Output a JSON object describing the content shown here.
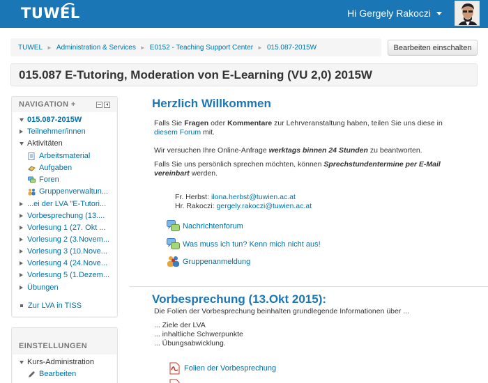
{
  "topbar": {
    "logo": "TUWEL",
    "greeting": "Hi Gergely Rakoczi",
    "colors": {
      "bar": "#1b76b6"
    }
  },
  "breadcrumb": [
    "TUWEL",
    "Administration & Services",
    "E0152 - Teaching Support Center",
    "015.087-2015W"
  ],
  "edit_button": "Bearbeiten einschalten",
  "page_title": "015.087 E-Tutoring, Moderation von E-Learning (VU 2,0) 2015W",
  "navigation": {
    "title": "NAVIGATION",
    "add_symbol": "+",
    "items": [
      {
        "label": "015.087-2015W",
        "icon": "tri-down"
      },
      {
        "label": "Teilnehmer/innen",
        "icon": "tri-right"
      },
      {
        "label": "Aktivitäten",
        "icon": "tri-down"
      },
      {
        "label": "Arbeitsmaterial",
        "icon": "resource-icon"
      },
      {
        "label": "Aufgaben",
        "icon": "assignment-icon"
      },
      {
        "label": "Foren",
        "icon": "forum-icon"
      },
      {
        "label": "Gruppenverwaltun...",
        "icon": "groups-icon"
      },
      {
        "label": "...ei der LVA \"E-Tutori...",
        "icon": "tri-right"
      },
      {
        "label": "Vorbesprechung (13....",
        "icon": "tri-right"
      },
      {
        "label": "Vorlesung 1 (27. Okt ...",
        "icon": "tri-right"
      },
      {
        "label": "Vorlesung 2 (3.Novem...",
        "icon": "tri-right"
      },
      {
        "label": "Vorlesung 3 (10.Nove...",
        "icon": "tri-right"
      },
      {
        "label": "Vorlesung 4 (24.Nove...",
        "icon": "tri-right"
      },
      {
        "label": "Vorlesung 5 (1.Dezem...",
        "icon": "tri-right"
      },
      {
        "label": "Übungen",
        "icon": "tri-right"
      },
      {
        "label": "Zur LVA in TISS",
        "icon": "bullet"
      }
    ]
  },
  "settings": {
    "title": "EINSTELLUNGEN",
    "items": [
      {
        "label": "Kurs-Administration",
        "icon": "tri-down"
      },
      {
        "label": "Bearbeiten",
        "icon": "pencil-icon"
      }
    ]
  },
  "welcome": {
    "title": "Herzlich Willkommen",
    "p1_a": "Falls Sie ",
    "p1_b": "Fragen",
    "p1_c": " oder ",
    "p1_d": "Kommentare",
    "p1_e": " zur Lehrveranstaltung haben, teilen Sie uns diese in",
    "p1_link": "diesem Forum",
    "p1_f": " mit.",
    "p2_a": "Wir versuchen Ihre Online-Anfrage ",
    "p2_b": "werktags binnen 24 Stunden",
    "p2_c": " zu beantworten.",
    "p3_a": "Falls Sie uns persönlich sprechen möchten, können ",
    "p3_b": "Sprechstundentermine per E-Mail",
    "p3_c": "vereinbart",
    "p3_d": " werden.",
    "contact1_label": "Fr. Herbst: ",
    "contact1_email": "ilona.herbst@tuwien.ac.at",
    "contact2_label": "Hr. Rakoczi: ",
    "contact2_email": "gergely.rakoczi@tuwien.ac.at",
    "activities": [
      {
        "label": "Nachrichtenforum",
        "icon": "forum-icon"
      },
      {
        "label": "Was muss ich tun? Kenn mich nicht aus!",
        "icon": "forum-icon"
      },
      {
        "label": "Gruppenanmeldung",
        "icon": "groups-icon"
      }
    ]
  },
  "vorbesprechung": {
    "title": "Vorbesprechung (13.Okt 2015):",
    "intro": "Die Folien der Vorbesprechung beinhalten grundlegende Informationen über ...",
    "points": [
      "... Ziele der LVA",
      "... inhaltliche Schwerpunkte",
      "... Übungsabwicklung."
    ],
    "file_link": "Folien der Vorbesprechung"
  }
}
